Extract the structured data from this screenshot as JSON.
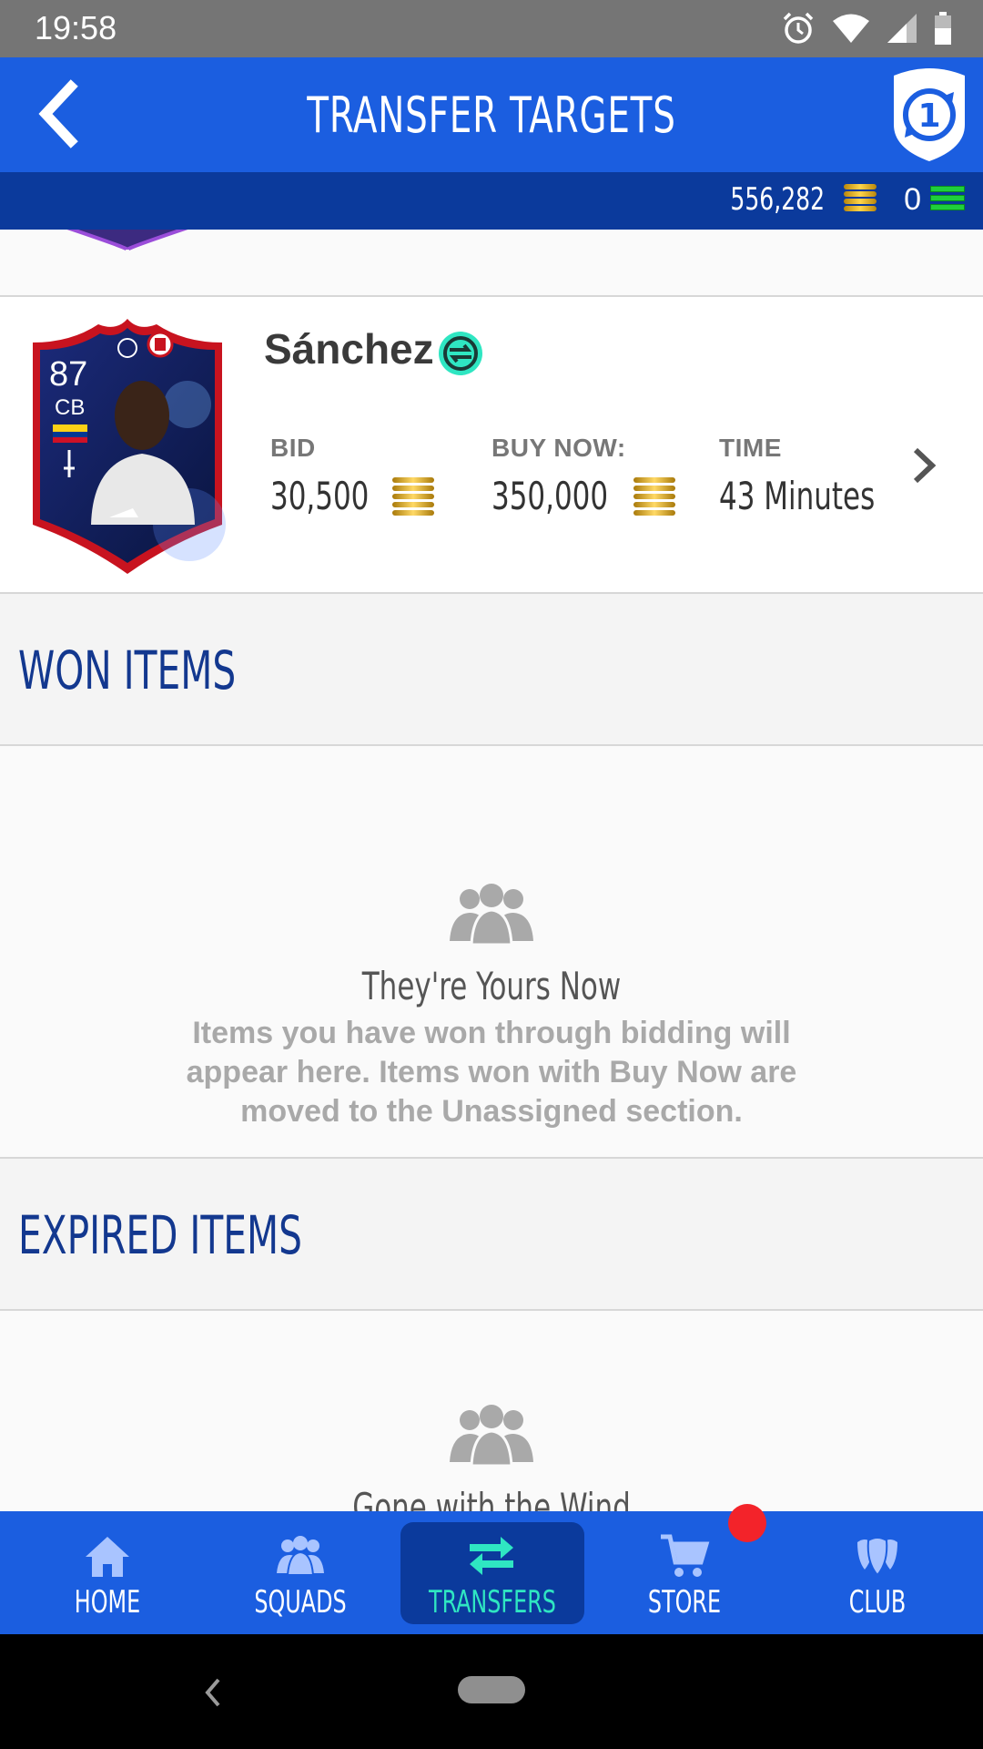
{
  "status_bar": {
    "time": "19:58"
  },
  "app_bar": {
    "title": "TRANSFER TARGETS"
  },
  "currency": {
    "coins": "556,282",
    "points": "0"
  },
  "item": {
    "rating": "87",
    "position": "CB",
    "name": "Sánchez",
    "bid_label": "BID",
    "bid_value": "30,500",
    "buy_now_label": "BUY NOW:",
    "buy_now_value": "350,000",
    "time_label": "TIME",
    "time_value": "43 Minutes"
  },
  "won_section": {
    "heading": "WON ITEMS",
    "empty_title": "They're Yours Now",
    "empty_line1": "Items you have won through bidding will",
    "empty_line2": "appear here. Items won with Buy Now are",
    "empty_line3": "moved to the Unassigned section."
  },
  "expired_section": {
    "heading": "EXPIRED ITEMS",
    "empty_title": "Gone with the Wind"
  },
  "bottom_nav": {
    "home": "HOME",
    "squads": "SQUADS",
    "transfers": "TRANSFERS",
    "store": "STORE",
    "club": "CLUB"
  },
  "colors": {
    "primary": "#1b5ee0",
    "dark": "#0b3a9c",
    "accent": "#2fe6c2",
    "heading": "#13388f"
  }
}
